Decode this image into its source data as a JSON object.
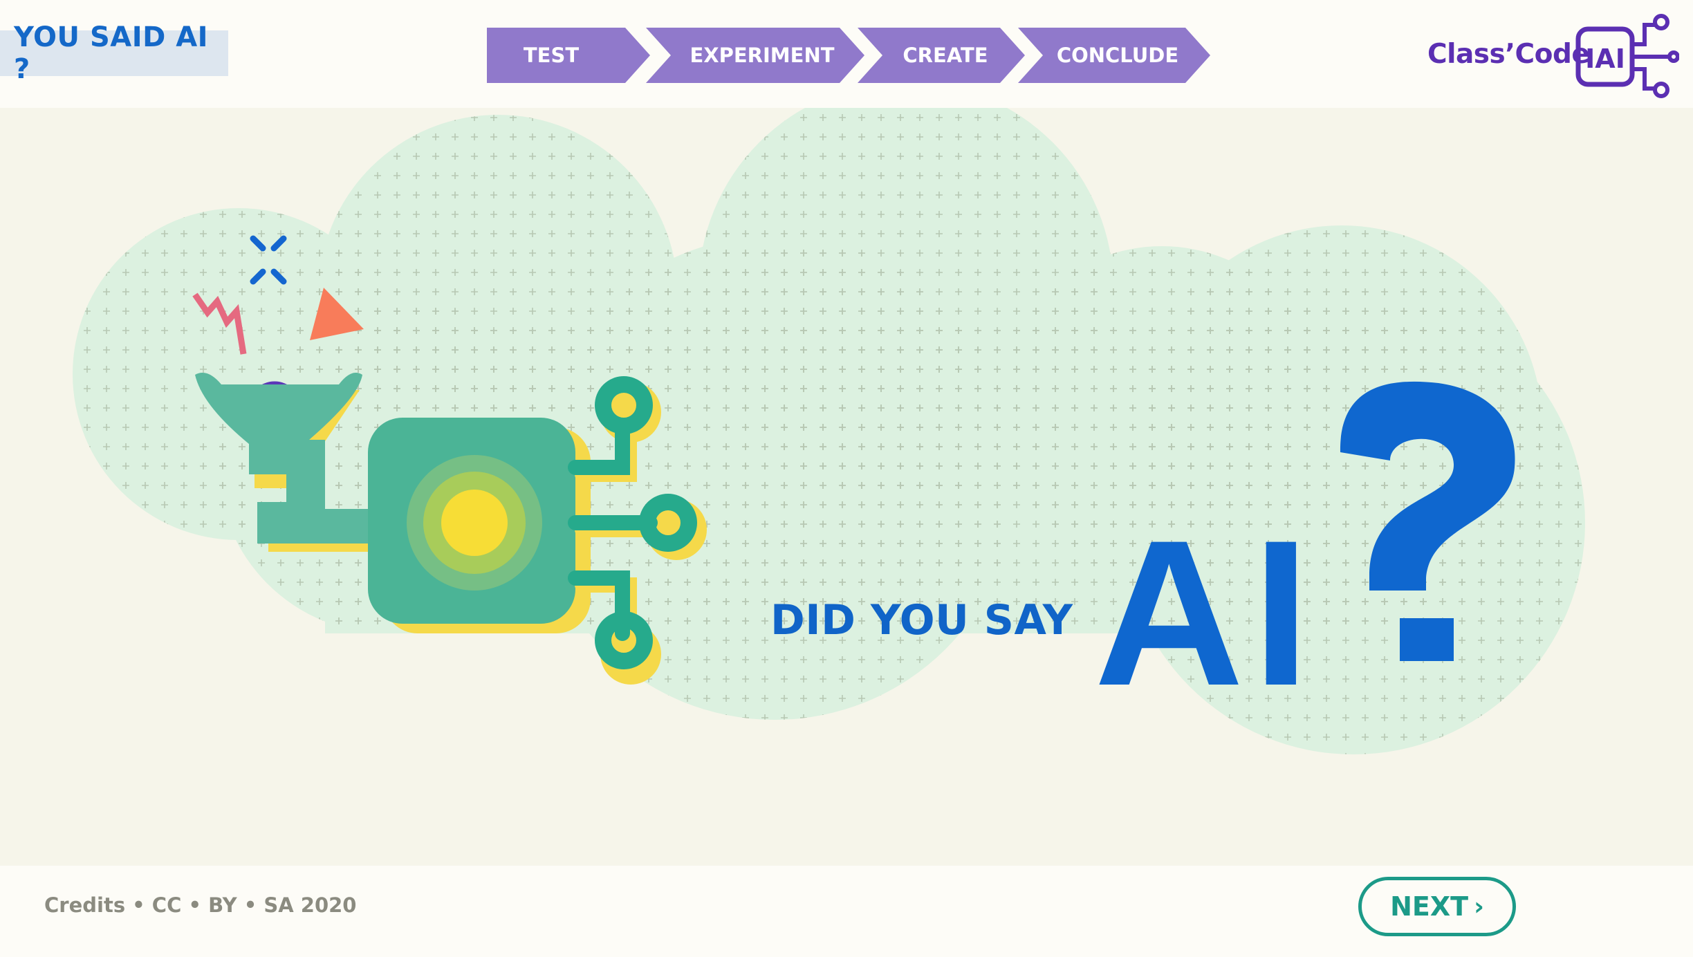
{
  "header": {
    "title": "YOU SAID AI ?",
    "steps": [
      {
        "label": "TEST"
      },
      {
        "label": "EXPERIMENT"
      },
      {
        "label": "CREATE"
      },
      {
        "label": "CONCLUDE"
      }
    ],
    "logo": {
      "text": "Class’Code",
      "mark_text": "IAI"
    }
  },
  "main": {
    "subtitle": "DID YOU SAY",
    "headline": "AI",
    "icon": "ai-robot-illustration"
  },
  "footer": {
    "credits": "Credits • CC • BY • SA 2020",
    "next_label": "NEXT",
    "next_icon": "chevron-right-icon"
  },
  "colors": {
    "step_purple": "#9079cb",
    "brand_blue": "#1064c8",
    "logo_purple": "#5b2fb2",
    "cloud_green": "#dcf1e0",
    "robot_teal": "#4bb496",
    "next_teal": "#1c9a88"
  }
}
